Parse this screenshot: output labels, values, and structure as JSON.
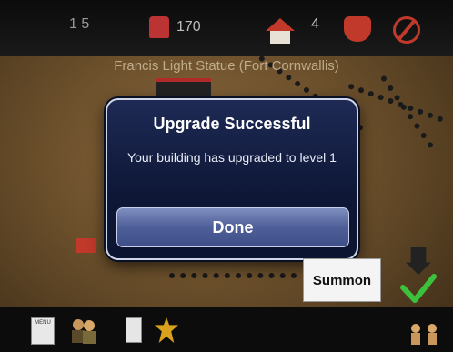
{
  "hud": {
    "resource_value": "170",
    "houses_value": "4"
  },
  "location_title": "Francis Light Statue (Fort Cornwallis)",
  "dialog": {
    "title": "Upgrade Successful",
    "message": "Your building has upgraded to level 1",
    "done_label": "Done"
  },
  "summon_label": "Summon",
  "bottom_bar": {
    "menu_text": "MENU"
  }
}
